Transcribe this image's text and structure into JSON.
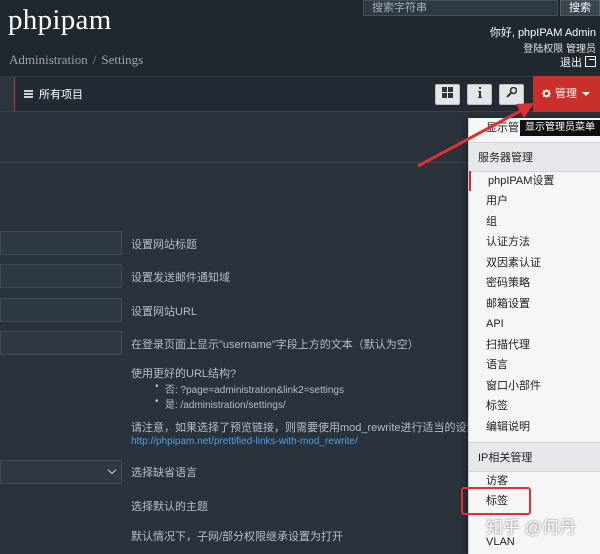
{
  "app": {
    "title": "phpipam",
    "breadcrumb": [
      "Administration",
      "Settings"
    ]
  },
  "search": {
    "placeholder": "搜索字符串",
    "button": "搜索"
  },
  "user": {
    "greeting": "你好, phpIPAM Admin",
    "links": "登陆权限 管理员",
    "logout": "退出"
  },
  "navbar": {
    "all_items": "所有项目",
    "toolbar_icons": [
      "grid-icon",
      "info-icon",
      "wrench-icon"
    ],
    "admin_button": "管理",
    "admin_icon": "gear-icon"
  },
  "settings": {
    "rows": [
      {
        "hint": "设置网站标题"
      },
      {
        "hint": "设置发送邮件通知域"
      },
      {
        "hint": "设置网站URL"
      },
      {
        "hint": "在登录页面上显示\"username\"字段上方的文本（默认为空）"
      }
    ],
    "pretty_links": {
      "label": "使用更好的URL结构?",
      "no": "否: ?page=administration&link2=settings",
      "yes": "是: /administration/settings/",
      "note": "请注意，如果选择了预览链接，则需要使用mod_rewrite进行适当的设置",
      "link": "http://phpipam.net/prettified-links-with-mod_rewrite/"
    },
    "language_hint": "选择缺省语言",
    "theme_hint": "选择默认的主题",
    "inherit_hint": "默认情况下，子网/部分权限继承设置为打开"
  },
  "tooltip": {
    "under": "显示管",
    "text": "显示管理员菜单"
  },
  "menu": {
    "server_header": "服务器管理",
    "server_items": [
      "phpIPAM设置",
      "用户",
      "组",
      "认证方法",
      "双因素认证",
      "密码策略",
      "邮箱设置",
      "API",
      "扫描代理",
      "语言",
      "窗口小部件",
      "标签",
      "编辑说明"
    ],
    "ip_header": "IP相关管理",
    "ip_items": [
      "访客",
      "标签",
      "VLAN"
    ]
  },
  "watermark": "知乎 @何丹",
  "colors": {
    "accent": "#c9302c",
    "link": "#4aa0e8",
    "annotation": "#e03030"
  }
}
